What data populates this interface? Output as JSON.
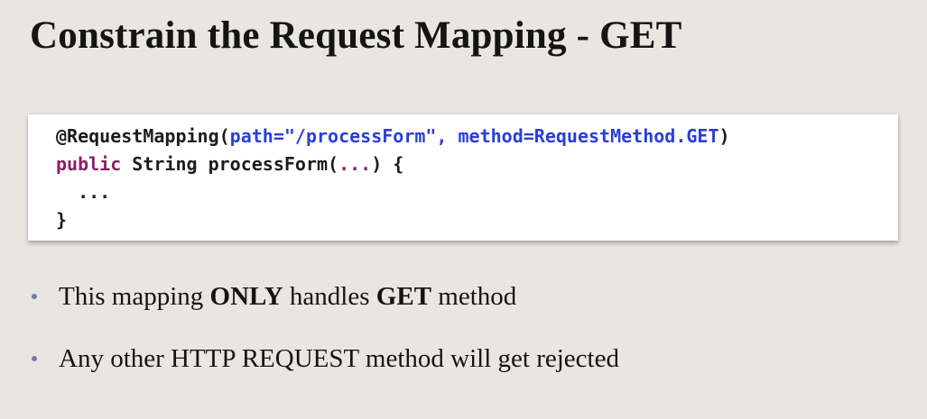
{
  "slide": {
    "title": "Constrain the Request Mapping - GET"
  },
  "code": {
    "line1": {
      "annotation": "@RequestMapping(",
      "args": "path=\"/processForm\", method=RequestMethod.GET",
      "close": ")"
    },
    "line2": {
      "keyword": "public",
      "rest": " String processForm(",
      "ellipsis": "...",
      "end": ") {"
    },
    "line3": "  ...",
    "line4": "}"
  },
  "bullets": [
    {
      "prefix": "This mapping ",
      "bold1": "ONLY",
      "middle": " handles ",
      "bold2": "GET",
      "suffix": " method"
    },
    {
      "text": "Any other HTTP REQUEST method will get rejected"
    }
  ],
  "colors": {
    "background": "#e9e6e1",
    "code_blue": "#2a3ed8",
    "code_purple": "#8a1f66",
    "bullet": "#6b7fa6"
  }
}
